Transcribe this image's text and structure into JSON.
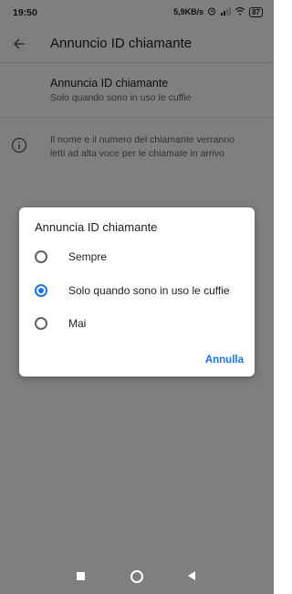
{
  "status_bar": {
    "time": "19:50",
    "speed": "5,9KB/s",
    "battery": "87"
  },
  "app_bar": {
    "title": "Annuncio ID chiamante",
    "back_icon": "arrow-back-icon"
  },
  "setting": {
    "title": "Annuncia ID chiamante",
    "subtitle": "Solo quando sono in uso le cuffie"
  },
  "info": {
    "icon": "info-icon",
    "text": "Il nome e il numero del chiamante verranno letti ad alta voce per le chiamate in arrivo"
  },
  "dialog": {
    "title": "Annuncia ID chiamante",
    "options": [
      {
        "label": "Sempre",
        "checked": false
      },
      {
        "label": "Solo quando sono in uso le cuffie",
        "checked": true
      },
      {
        "label": "Mai",
        "checked": false
      }
    ],
    "cancel_label": "Annulla"
  },
  "colors": {
    "accent": "#1a73e8",
    "scrim": "rgba(0,0,0,0.5)"
  }
}
